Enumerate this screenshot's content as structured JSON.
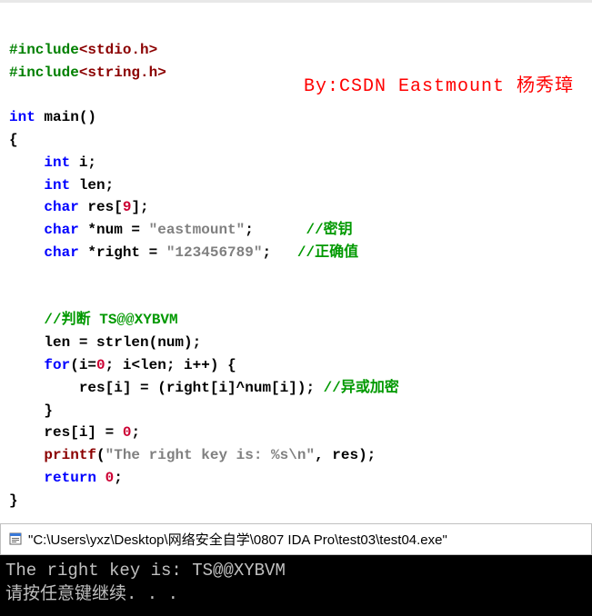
{
  "watermark": "By:CSDN Eastmount 杨秀璋",
  "code": {
    "l1_a": "#include",
    "l1_b": "<stdio.h>",
    "l2_a": "#include",
    "l2_b": "<string.h>",
    "l4_a": "int",
    "l4_b": " main()",
    "l5": "{",
    "l6_a": "    ",
    "l6_b": "int",
    "l6_c": " i;",
    "l7_a": "    ",
    "l7_b": "int",
    "l7_c": " len;",
    "l8_a": "    ",
    "l8_b": "char",
    "l8_c": " res[",
    "l8_d": "9",
    "l8_e": "];",
    "l9_a": "    ",
    "l9_b": "char",
    "l9_c": " *num = ",
    "l9_d": "\"eastmount\"",
    "l9_e": ";      ",
    "l9_f": "//密钥",
    "l10_a": "    ",
    "l10_b": "char",
    "l10_c": " *right = ",
    "l10_d": "\"123456789\"",
    "l10_e": ";   ",
    "l10_f": "//正确值",
    "l13_a": "    ",
    "l13_b": "//判断 TS@@XYBVM",
    "l14": "    len = strlen(num);",
    "l15_a": "    ",
    "l15_b": "for",
    "l15_c": "(i=",
    "l15_d": "0",
    "l15_e": "; i<len; i++) {",
    "l16_a": "        res[i] = (right[i]^num[i]); ",
    "l16_b": "//异或加密",
    "l17": "    }",
    "l18_a": "    res[i] = ",
    "l18_b": "0",
    "l18_c": ";",
    "l19_a": "    ",
    "l19_b": "printf",
    "l19_c": "(",
    "l19_d": "\"The right key is: %s\\n\"",
    "l19_e": ", res);",
    "l20_a": "    ",
    "l20_b": "return",
    "l20_c": " ",
    "l20_d": "0",
    "l20_e": ";",
    "l21": "}"
  },
  "title_path": "\"C:\\Users\\yxz\\Desktop\\网络安全自学\\0807 IDA Pro\\test03\\test04.exe\"",
  "console_line1": "The right key is: TS@@XYBVM",
  "console_line2": "请按任意键继续. . ."
}
